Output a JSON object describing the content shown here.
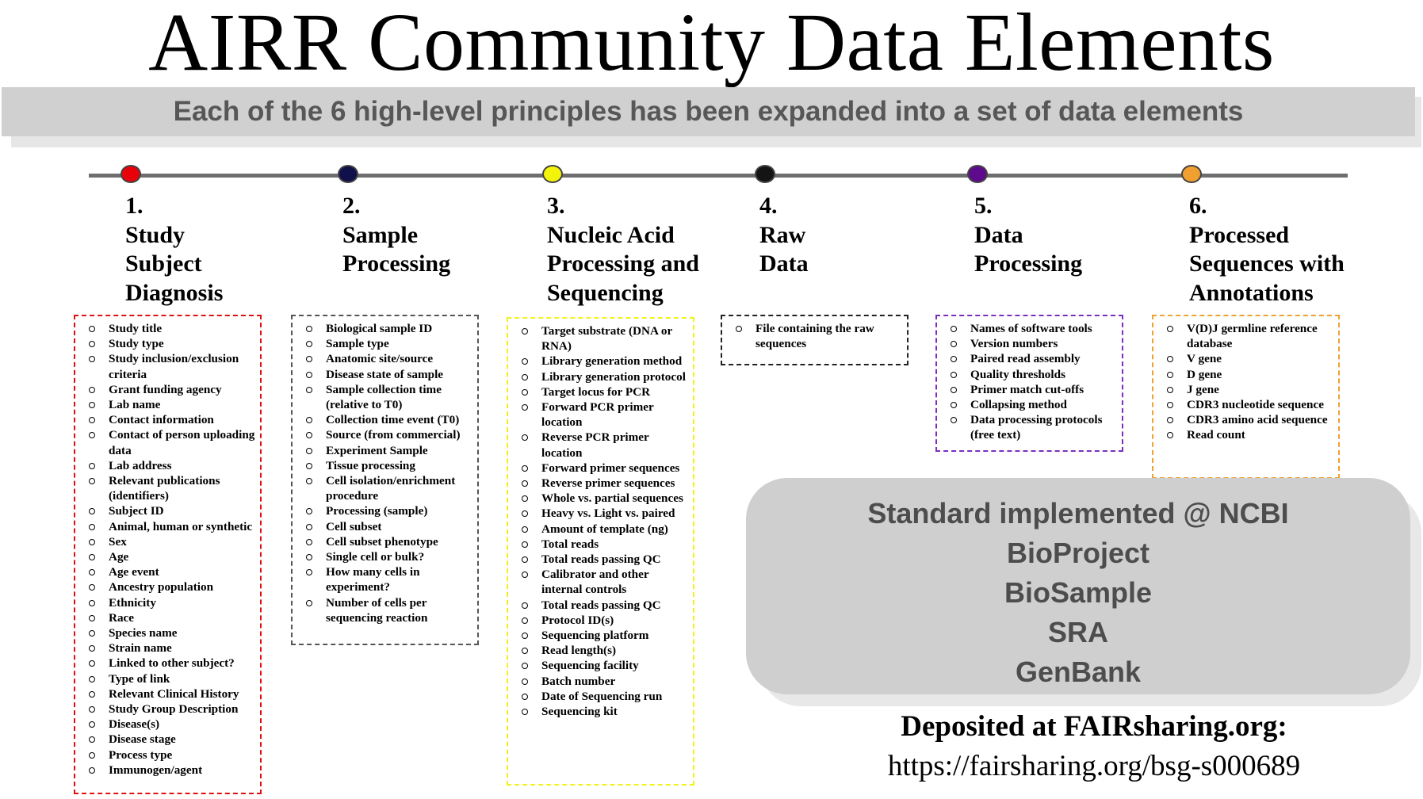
{
  "title": "AIRR Community Data Elements",
  "subtitle": "Each of the 6 high-level principles has been expanded into a set of data elements",
  "colors": {
    "step1": "#e8000b",
    "step2": "#10104a",
    "step3": "#f4f40a",
    "step4": "#141414",
    "step5": "#5e0a8c",
    "step6": "#f0a030",
    "box1_border": "#e01010",
    "box2_border": "#555555",
    "box3_border": "#f2f21a",
    "box4_border": "#222222",
    "box5_border": "#7a2fc0",
    "box6_border": "#f0a030"
  },
  "steps": [
    {
      "number": "1.",
      "title_lines": [
        "Study",
        "Subject",
        "Diagnosis"
      ],
      "items": [
        "Study title",
        "Study type",
        "Study inclusion/exclusion criteria",
        "Grant funding agency",
        "Lab name",
        "Contact information",
        "Contact of person uploading data",
        "Lab address",
        "Relevant publications (identifiers)",
        "Subject ID",
        "Animal, human or synthetic",
        "Sex",
        "Age",
        "Age event",
        "Ancestry population",
        "Ethnicity",
        "Race",
        "Species name",
        "Strain name",
        "Linked to other subject?",
        "Type of link",
        "Relevant Clinical History",
        "Study Group Description",
        "Disease(s)",
        "Disease stage",
        "Process type",
        "Immunogen/agent"
      ]
    },
    {
      "number": "2.",
      "title_lines": [
        "Sample",
        "Processing"
      ],
      "items": [
        "Biological sample ID",
        "Sample type",
        "Anatomic site/source",
        "Disease state of sample",
        "Sample collection time (relative to T0)",
        "Collection time event (T0)",
        "Source (from commercial)",
        "Experiment Sample",
        "Tissue processing",
        "Cell isolation/enrichment procedure",
        "Processing (sample)",
        "Cell subset",
        "Cell subset phenotype",
        "Single cell or bulk?",
        "How many cells in experiment?",
        "Number of cells per sequencing reaction"
      ]
    },
    {
      "number": "3.",
      "title_lines": [
        "Nucleic Acid",
        "Processing and",
        "Sequencing"
      ],
      "items": [
        "Target substrate (DNA or RNA)",
        "Library generation method",
        "Library generation protocol",
        "Target locus for PCR",
        "Forward PCR primer location",
        "Reverse PCR primer location",
        "Forward primer sequences",
        "Reverse primer sequences",
        "Whole vs. partial sequences",
        "Heavy vs. Light vs. paired",
        "Amount of template (ng)",
        "Total reads",
        "Total reads passing QC",
        "Calibrator and other internal controls",
        "Total reads passing QC",
        "Protocol ID(s)",
        "Sequencing platform",
        "Read length(s)",
        "Sequencing facility",
        "Batch number",
        "Date of Sequencing run",
        "Sequencing kit"
      ]
    },
    {
      "number": "4.",
      "title_lines": [
        "Raw",
        "Data"
      ],
      "items": [
        "File containing the raw sequences"
      ]
    },
    {
      "number": "5.",
      "title_lines": [
        "Data",
        "Processing"
      ],
      "items": [
        "Names of software tools",
        "Version numbers",
        "Paired read assembly",
        "Quality thresholds",
        "Primer match cut-offs",
        "Collapsing method",
        "Data processing protocols (free text)"
      ]
    },
    {
      "number": "6.",
      "title_lines": [
        "Processed",
        "Sequences with",
        "Annotations"
      ],
      "items": [
        "V(D)J germline reference database",
        "V gene",
        "D gene",
        "J gene",
        "CDR3 nucleotide sequence",
        "CDR3 amino acid sequence",
        "Read count"
      ]
    }
  ],
  "ncbi": {
    "lines": [
      "Standard implemented @ NCBI",
      "BioProject",
      "BioSample",
      "SRA",
      "GenBank"
    ]
  },
  "deposit": {
    "label": "Deposited at FAIRsharing.org:",
    "url": "https://fairsharing.org/bsg-s000689"
  }
}
